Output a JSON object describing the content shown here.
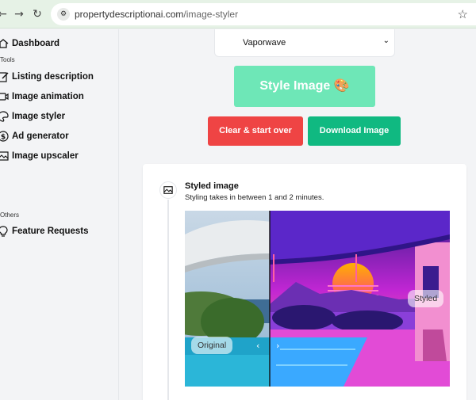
{
  "browser": {
    "url_domain": "propertydescriptionai.com",
    "url_path": "/image-styler"
  },
  "sidebar": {
    "dashboard": "Dashboard",
    "tools_heading": "Tools",
    "items": [
      {
        "label": "Listing description",
        "icon": "edit-icon"
      },
      {
        "label": "Image animation",
        "icon": "video-icon"
      },
      {
        "label": "Image styler",
        "icon": "palette-icon"
      },
      {
        "label": "Ad generator",
        "icon": "dollar-icon"
      },
      {
        "label": "Image upscaler",
        "icon": "image-icon"
      }
    ],
    "others_heading": "Others",
    "feature_requests": "Feature Requests"
  },
  "main": {
    "style_select": "Vaporwave",
    "style_button": "Style Image 🎨",
    "clear_button": "Clear & start over",
    "download_button": "Download Image",
    "card_title": "Styled image",
    "card_subtitle": "Styling takes in between 1 and 2 minutes.",
    "label_original": "Original",
    "label_styled": "Styled"
  },
  "colors": {
    "style_button": "#6ee7b7",
    "clear_button": "#ef4444",
    "download_button": "#10b981"
  }
}
